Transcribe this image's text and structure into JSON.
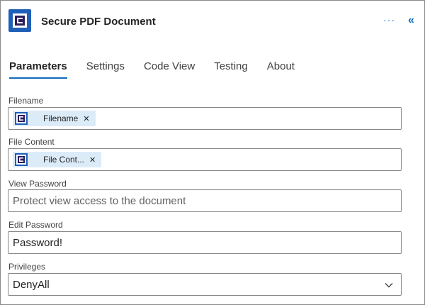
{
  "header": {
    "title": "Secure PDF Document",
    "more_label": "···",
    "collapse_label": "«"
  },
  "tabs": [
    {
      "label": "Parameters",
      "active": true
    },
    {
      "label": "Settings",
      "active": false
    },
    {
      "label": "Code View",
      "active": false
    },
    {
      "label": "Testing",
      "active": false
    },
    {
      "label": "About",
      "active": false
    }
  ],
  "fields": {
    "filename": {
      "label": "Filename",
      "token": "Filename"
    },
    "file_content": {
      "label": "File Content",
      "token": "File Cont..."
    },
    "view_password": {
      "label": "View Password",
      "placeholder": "Protect view access to the document"
    },
    "edit_password": {
      "label": "Edit Password",
      "value": "Password!"
    },
    "privileges": {
      "label": "Privileges",
      "value": "DenyAll"
    }
  },
  "colors": {
    "accent": "#0f6cbd",
    "app_icon": "#1f5fb8",
    "token_bg": "#dcebf8"
  }
}
